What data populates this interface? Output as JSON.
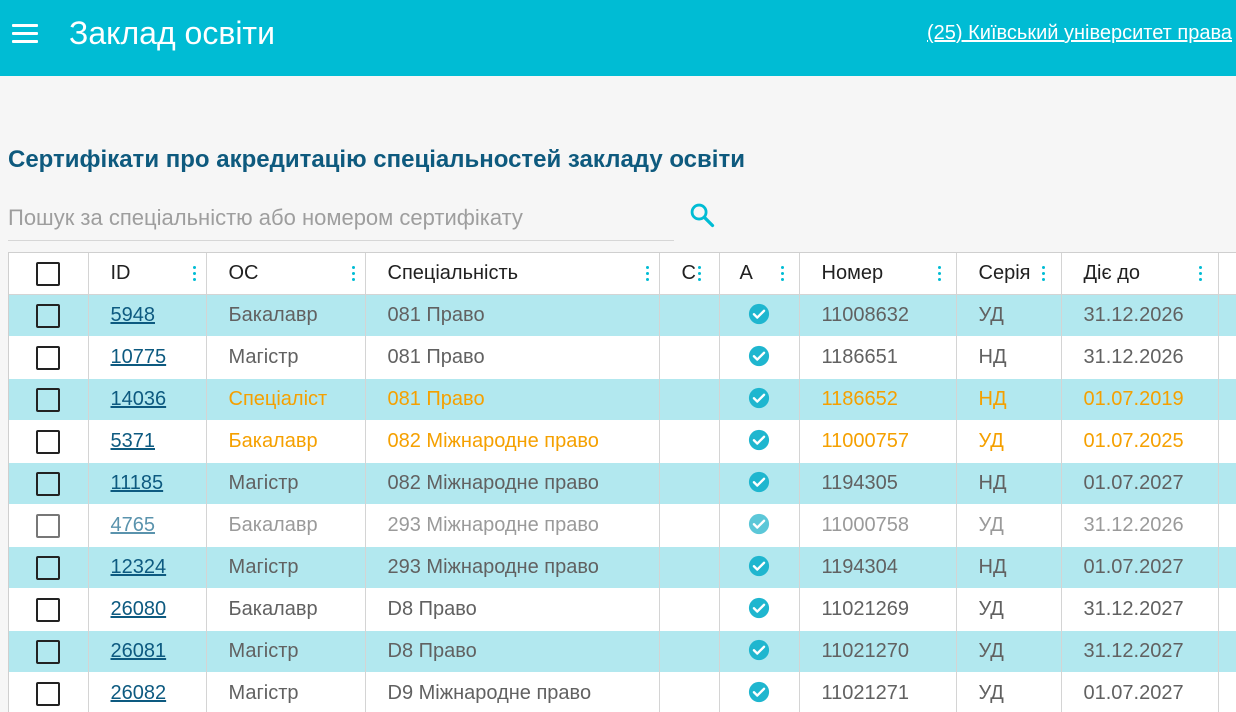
{
  "header": {
    "title": "Заклад освіти",
    "institution_link": "(25) Київський університет права"
  },
  "colors": {
    "accent": "#00bcd4",
    "title": "#0e5a7e",
    "warning": "#f5a000",
    "row_highlight": "#b2e8ef"
  },
  "section_title": "Сертифікати про акредитацію спеціальностей закладу освіти",
  "search": {
    "placeholder": "Пошук за спеціальністю або номером сертифікату",
    "value": ""
  },
  "table": {
    "columns": [
      "ID",
      "ОС",
      "Спеціальність",
      "С",
      "А",
      "Номер",
      "Серія",
      "Діє до"
    ],
    "rows": [
      {
        "id": "5948",
        "level": "Бакалавр",
        "specialty": "081 Право",
        "accredited": true,
        "number": "11008632",
        "series": "УД",
        "valid_until": "31.12.2026",
        "status": "normal"
      },
      {
        "id": "10775",
        "level": "Магістр",
        "specialty": "081 Право",
        "accredited": true,
        "number": "1186651",
        "series": "НД",
        "valid_until": "31.12.2026",
        "status": "normal"
      },
      {
        "id": "14036",
        "level": "Спеціаліст",
        "specialty": "081 Право",
        "accredited": true,
        "number": "1186652",
        "series": "НД",
        "valid_until": "01.07.2019",
        "status": "warning"
      },
      {
        "id": "5371",
        "level": "Бакалавр",
        "specialty": "082 Міжнародне право",
        "accredited": true,
        "number": "11000757",
        "series": "УД",
        "valid_until": "01.07.2025",
        "status": "warning"
      },
      {
        "id": "11185",
        "level": "Магістр",
        "specialty": "082 Міжнародне право",
        "accredited": true,
        "number": "1194305",
        "series": "НД",
        "valid_until": "01.07.2027",
        "status": "normal"
      },
      {
        "id": "4765",
        "level": "Бакалавр",
        "specialty": "293 Міжнародне право",
        "accredited": true,
        "number": "11000758",
        "series": "УД",
        "valid_until": "31.12.2026",
        "status": "dimmed"
      },
      {
        "id": "12324",
        "level": "Магістр",
        "specialty": "293 Міжнародне право",
        "accredited": true,
        "number": "1194304",
        "series": "НД",
        "valid_until": "01.07.2027",
        "status": "normal"
      },
      {
        "id": "26080",
        "level": "Бакалавр",
        "specialty": "D8 Право",
        "accredited": true,
        "number": "11021269",
        "series": "УД",
        "valid_until": "31.12.2027",
        "status": "normal"
      },
      {
        "id": "26081",
        "level": "Магістр",
        "specialty": "D8 Право",
        "accredited": true,
        "number": "11021270",
        "series": "УД",
        "valid_until": "31.12.2027",
        "status": "normal"
      },
      {
        "id": "26082",
        "level": "Магістр",
        "specialty": "D9 Міжнародне право",
        "accredited": true,
        "number": "11021271",
        "series": "УД",
        "valid_until": "01.07.2027",
        "status": "normal"
      }
    ]
  }
}
